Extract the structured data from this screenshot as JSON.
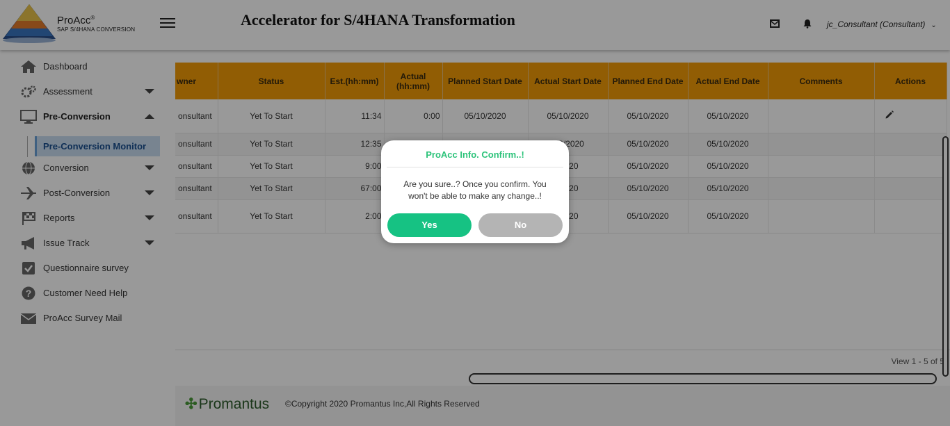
{
  "header": {
    "brand_name": "ProAcc",
    "brand_mark": "®",
    "brand_sub": "SAP S/4HANA CONVERSION",
    "title": "Accelerator for S/4HANA Transformation",
    "user_label": "jc_Consultant (Consultant)",
    "icons": [
      "mail-icon",
      "bell-icon",
      "chevron-down-icon"
    ]
  },
  "sidebar": {
    "items": [
      {
        "label": "Dashboard",
        "icon": "home-icon"
      },
      {
        "label": "Assessment",
        "icon": "gears-icon"
      },
      {
        "label": "Pre-Conversion",
        "icon": "monitor-icon"
      },
      {
        "label": "Pre-Conversion Monitor"
      },
      {
        "label": "Conversion",
        "icon": "globe-icon"
      },
      {
        "label": "Post-Conversion",
        "icon": "plane-icon"
      },
      {
        "label": "Reports",
        "icon": "flag-icon"
      },
      {
        "label": "Issue Track",
        "icon": "megaphone-icon"
      },
      {
        "label": "Questionnaire survey",
        "icon": "checkbox-icon"
      },
      {
        "label": "Customer Need Help",
        "icon": "question-icon"
      },
      {
        "label": "ProAcc Survey Mail",
        "icon": "envelope-icon"
      }
    ]
  },
  "table": {
    "columns": [
      "wner",
      "Status",
      "Est.(hh:mm)",
      "Actual (hh:mm)",
      "Planned Start Date",
      "Actual Start Date",
      "Planned End Date",
      "Actual End Date",
      "Comments",
      "Actions"
    ],
    "rows": [
      [
        "onsultant",
        "Yet To Start",
        "11:34",
        "0:00",
        "05/10/2020",
        "05/10/2020",
        "05/10/2020",
        "05/10/2020",
        "",
        ""
      ],
      [
        "onsultant",
        "Yet To Start",
        "12:35",
        "",
        "",
        "/10/2020",
        "05/10/2020",
        "05/10/2020",
        "",
        ""
      ],
      [
        "onsultant",
        "Yet To Start",
        "9:00",
        "",
        "",
        "/2020",
        "05/10/2020",
        "05/10/2020",
        "",
        ""
      ],
      [
        "onsultant",
        "Yet To Start",
        "67:00",
        "",
        "",
        "/2020",
        "05/10/2020",
        "05/10/2020",
        "",
        ""
      ],
      [
        "onsultant",
        "Yet To Start",
        "2:00",
        "",
        "",
        "/2020",
        "05/10/2020",
        "05/10/2020",
        "",
        ""
      ]
    ],
    "pager": "View 1 - 5 of 5"
  },
  "footer": {
    "logo_text": "Promantus",
    "copyright": "©Copyright 2020 Promantus Inc,All Rights Reserved"
  },
  "modal": {
    "title": "ProAcc Info. Confirm..!",
    "message": "Are you sure..? Once you confirm. You won't be able to make any change..!",
    "yes_label": "Yes",
    "no_label": "No",
    "colors": {
      "title": "#2cc37a",
      "yes": "#16c283",
      "no": "#b4b4b4"
    }
  },
  "colors": {
    "table_header": "#f29b07",
    "active_nav": "#c8dcf0"
  }
}
